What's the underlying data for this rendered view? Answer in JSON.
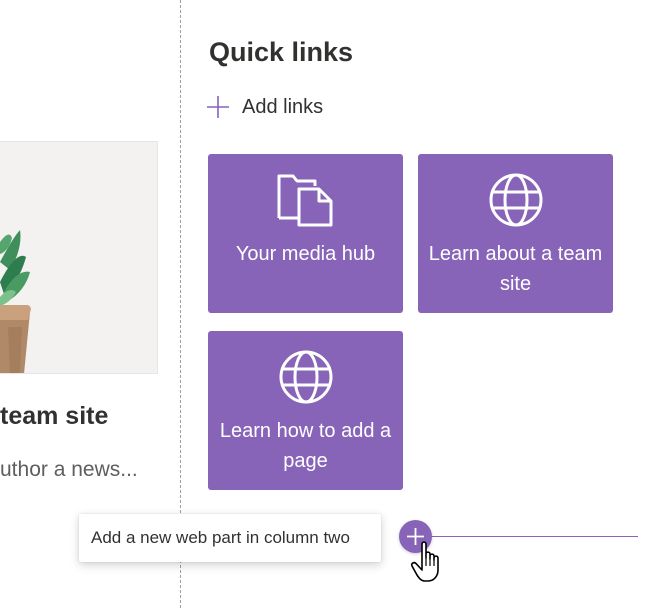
{
  "news": {
    "title_fragment": "team site",
    "description_fragment": "uthor a news..."
  },
  "quick_links": {
    "title": "Quick links",
    "add_links_label": "Add links",
    "accent_color": "#8764b8",
    "tiles": [
      {
        "label": "Your media hub",
        "icon": "document-folder-icon"
      },
      {
        "label": "Learn about a team site",
        "icon": "globe-icon"
      },
      {
        "label": "Learn how to add a page",
        "icon": "globe-icon"
      }
    ]
  },
  "add_webpart": {
    "tooltip": "Add a new web part in column two",
    "icon": "plus-icon"
  }
}
